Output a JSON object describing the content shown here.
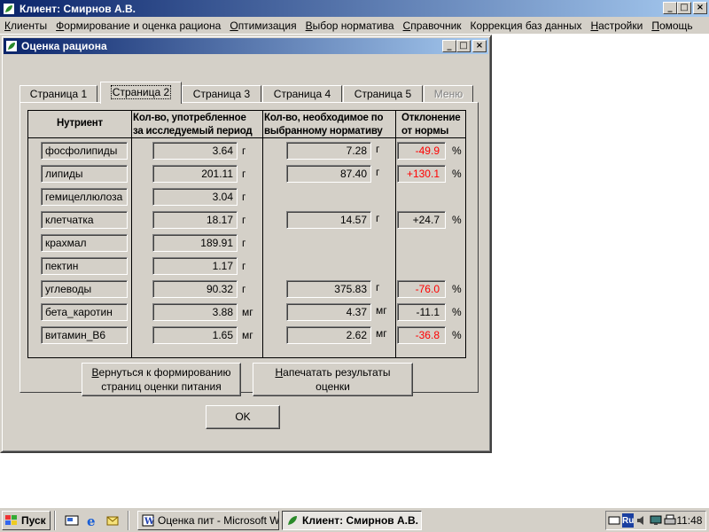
{
  "main_window": {
    "title": "Клиент: Смирнов А.В.",
    "buttons": {
      "minimize": "_",
      "maximize": "□",
      "close": "×"
    }
  },
  "menu": [
    {
      "pre": "",
      "ul": "К",
      "post": "лиенты"
    },
    {
      "pre": "",
      "ul": "Ф",
      "post": "ормирование и оценка рациона"
    },
    {
      "pre": "",
      "ul": "О",
      "post": "птимизация"
    },
    {
      "pre": "",
      "ul": "В",
      "post": "ыбор норматива"
    },
    {
      "pre": "",
      "ul": "С",
      "post": "правочник"
    },
    {
      "pre": "Коррекция  баз ",
      "ul": "д",
      "post": "анных"
    },
    {
      "pre": "",
      "ul": "Н",
      "post": "астройки"
    },
    {
      "pre": "",
      "ul": "П",
      "post": "омощь"
    }
  ],
  "dialog": {
    "title": "Оценка рациона",
    "tabs": [
      "Страница 1",
      "Страница 2",
      "Страница 3",
      "Страница 4",
      "Страница 5",
      "Меню"
    ],
    "active_tab": "Страница 2",
    "headers": {
      "nutrient": "Нутриент",
      "consumed_1": "Кол-во, употребленное",
      "consumed_2": "за исследуемый период",
      "required_1": "Кол-во,  необходимое по",
      "required_2": "выбранному нормативу",
      "deviation_1": "Отклонение",
      "deviation_2": "от нормы"
    },
    "rows": [
      {
        "name": "фосфолипиды",
        "consumed": "3.64",
        "c_unit": "г",
        "required": "7.28",
        "r_unit": "г",
        "deviation": "-49.9",
        "pct": "%"
      },
      {
        "name": "липиды",
        "consumed": "201.11",
        "c_unit": "г",
        "required": "87.40",
        "r_unit": "г",
        "deviation": "+130.1",
        "pct": "%"
      },
      {
        "name": "гемицеллюлоза",
        "consumed": "3.04",
        "c_unit": "г"
      },
      {
        "name": "клетчатка",
        "consumed": "18.17",
        "c_unit": "г",
        "required": "14.57",
        "r_unit": "г",
        "deviation": "+24.7",
        "pct": "%"
      },
      {
        "name": "крахмал",
        "consumed": "189.91",
        "c_unit": "г"
      },
      {
        "name": "пектин",
        "consumed": "1.17",
        "c_unit": "г"
      },
      {
        "name": "углеводы",
        "consumed": "90.32",
        "c_unit": "г",
        "required": "375.83",
        "r_unit": "г",
        "deviation": "-76.0",
        "pct": "%"
      },
      {
        "name": "бета_каротин",
        "consumed": "3.88",
        "c_unit": "мг",
        "required": "4.37",
        "r_unit": "мг",
        "deviation": "-11.1",
        "pct": "%"
      },
      {
        "name": "витамин_В6",
        "consumed": "1.65",
        "c_unit": "мг",
        "required": "2.62",
        "r_unit": "мг",
        "deviation": "-36.8",
        "pct": "%"
      }
    ],
    "red_deviation_rows": [
      0,
      1,
      6,
      8
    ],
    "buttons": {
      "back_ul": "В",
      "back_line1_rest": "ернуться к формированию",
      "back_line2": "страниц оценки питания",
      "print_ul": "Н",
      "print_line1_rest": "апечатать результаты",
      "print_line2": "оценки",
      "ok": "OK"
    }
  },
  "taskbar": {
    "start": "Пуск",
    "tasks": [
      {
        "label": "Оценка пит - Microsoft W...",
        "pressed": false
      },
      {
        "label": "Клиент: Смирнов А.В.",
        "pressed": true
      }
    ],
    "tray_lang": "Ru",
    "clock": "11:48"
  },
  "colors": {
    "titlebar_start": "#0a246a",
    "titlebar_end": "#a6caf0",
    "face": "#d4d0c8",
    "negative_red": "#ff0000"
  }
}
